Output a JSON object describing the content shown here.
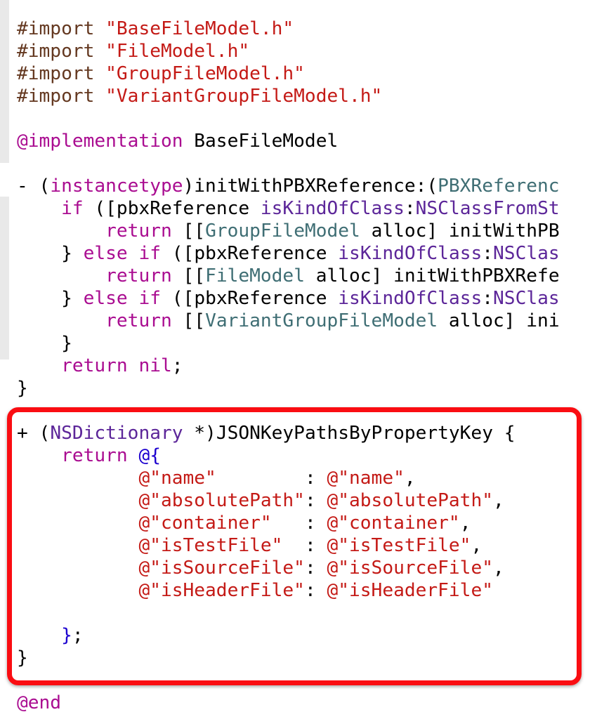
{
  "editor": {
    "lines": [
      [
        {
          "text": "#import ",
          "kind": "directive"
        },
        {
          "text": "\"BaseFileModel.h\"",
          "kind": "string"
        }
      ],
      [
        {
          "text": "#import ",
          "kind": "directive"
        },
        {
          "text": "\"FileModel.h\"",
          "kind": "string"
        }
      ],
      [
        {
          "text": "#import ",
          "kind": "directive"
        },
        {
          "text": "\"GroupFileModel.h\"",
          "kind": "string"
        }
      ],
      [
        {
          "text": "#import ",
          "kind": "directive"
        },
        {
          "text": "\"VariantGroupFileModel.h\"",
          "kind": "string"
        }
      ],
      [],
      [
        {
          "text": "@implementation",
          "kind": "keyword"
        },
        {
          "text": " BaseFileModel",
          "kind": "plain"
        }
      ],
      [],
      [
        {
          "text": "- (",
          "kind": "plain"
        },
        {
          "text": "instancetype",
          "kind": "keyword"
        },
        {
          "text": ")initWithPBXReference:(",
          "kind": "plain"
        },
        {
          "text": "PBXReferenc",
          "kind": "project-class"
        }
      ],
      [
        {
          "text": "    ",
          "kind": "plain"
        },
        {
          "text": "if",
          "kind": "keyword"
        },
        {
          "text": " ([pbxReference ",
          "kind": "plain"
        },
        {
          "text": "isKindOfClass",
          "kind": "type"
        },
        {
          "text": ":",
          "kind": "plain"
        },
        {
          "text": "NSClassFromSt",
          "kind": "type"
        }
      ],
      [
        {
          "text": "        ",
          "kind": "plain"
        },
        {
          "text": "return",
          "kind": "keyword"
        },
        {
          "text": " [[",
          "kind": "plain"
        },
        {
          "text": "GroupFileModel",
          "kind": "project-class"
        },
        {
          "text": " alloc] initWithPB",
          "kind": "plain"
        }
      ],
      [
        {
          "text": "    } ",
          "kind": "plain"
        },
        {
          "text": "else",
          "kind": "keyword"
        },
        {
          "text": " ",
          "kind": "plain"
        },
        {
          "text": "if",
          "kind": "keyword"
        },
        {
          "text": " ([pbxReference ",
          "kind": "plain"
        },
        {
          "text": "isKindOfClass",
          "kind": "type"
        },
        {
          "text": ":",
          "kind": "plain"
        },
        {
          "text": "NSClas",
          "kind": "type"
        }
      ],
      [
        {
          "text": "        ",
          "kind": "plain"
        },
        {
          "text": "return",
          "kind": "keyword"
        },
        {
          "text": " [[",
          "kind": "plain"
        },
        {
          "text": "FileModel",
          "kind": "project-class"
        },
        {
          "text": " alloc] initWithPBXRefe",
          "kind": "plain"
        }
      ],
      [
        {
          "text": "    } ",
          "kind": "plain"
        },
        {
          "text": "else",
          "kind": "keyword"
        },
        {
          "text": " ",
          "kind": "plain"
        },
        {
          "text": "if",
          "kind": "keyword"
        },
        {
          "text": " ([pbxReference ",
          "kind": "plain"
        },
        {
          "text": "isKindOfClass",
          "kind": "type"
        },
        {
          "text": ":",
          "kind": "plain"
        },
        {
          "text": "NSClas",
          "kind": "type"
        }
      ],
      [
        {
          "text": "        ",
          "kind": "plain"
        },
        {
          "text": "return",
          "kind": "keyword"
        },
        {
          "text": " [[",
          "kind": "plain"
        },
        {
          "text": "VariantGroupFileModel",
          "kind": "project-class"
        },
        {
          "text": " alloc] ini",
          "kind": "plain"
        }
      ],
      [
        {
          "text": "    }",
          "kind": "plain"
        }
      ],
      [
        {
          "text": "    ",
          "kind": "plain"
        },
        {
          "text": "return",
          "kind": "keyword"
        },
        {
          "text": " ",
          "kind": "plain"
        },
        {
          "text": "nil",
          "kind": "keyword"
        },
        {
          "text": ";",
          "kind": "plain"
        }
      ],
      [
        {
          "text": "}",
          "kind": "plain"
        }
      ],
      [],
      [
        {
          "text": "+ (",
          "kind": "plain"
        },
        {
          "text": "NSDictionary",
          "kind": "type"
        },
        {
          "text": " *)JSONKeyPathsByPropertyKey {",
          "kind": "plain"
        }
      ],
      [
        {
          "text": "    ",
          "kind": "plain"
        },
        {
          "text": "return",
          "kind": "keyword"
        },
        {
          "text": " ",
          "kind": "plain"
        },
        {
          "text": "@{",
          "kind": "brace-blue"
        }
      ],
      [
        {
          "text": "           ",
          "kind": "plain"
        },
        {
          "text": "@\"name\"",
          "kind": "string"
        },
        {
          "text": "        : ",
          "kind": "plain"
        },
        {
          "text": "@\"name\"",
          "kind": "string"
        },
        {
          "text": ",",
          "kind": "plain"
        }
      ],
      [
        {
          "text": "           ",
          "kind": "plain"
        },
        {
          "text": "@\"absolutePath\"",
          "kind": "string"
        },
        {
          "text": ": ",
          "kind": "plain"
        },
        {
          "text": "@\"absolutePath\"",
          "kind": "string"
        },
        {
          "text": ",",
          "kind": "plain"
        }
      ],
      [
        {
          "text": "           ",
          "kind": "plain"
        },
        {
          "text": "@\"container\"",
          "kind": "string"
        },
        {
          "text": "   : ",
          "kind": "plain"
        },
        {
          "text": "@\"container\"",
          "kind": "string"
        },
        {
          "text": ",",
          "kind": "plain"
        }
      ],
      [
        {
          "text": "           ",
          "kind": "plain"
        },
        {
          "text": "@\"isTestFile\"",
          "kind": "string"
        },
        {
          "text": "  : ",
          "kind": "plain"
        },
        {
          "text": "@\"isTestFile\"",
          "kind": "string"
        },
        {
          "text": ",",
          "kind": "plain"
        }
      ],
      [
        {
          "text": "           ",
          "kind": "plain"
        },
        {
          "text": "@\"isSourceFile\"",
          "kind": "string"
        },
        {
          "text": ": ",
          "kind": "plain"
        },
        {
          "text": "@\"isSourceFile\"",
          "kind": "string"
        },
        {
          "text": ",",
          "kind": "plain"
        }
      ],
      [
        {
          "text": "           ",
          "kind": "plain"
        },
        {
          "text": "@\"isHeaderFile\"",
          "kind": "string"
        },
        {
          "text": ": ",
          "kind": "plain"
        },
        {
          "text": "@\"isHeaderFile\"",
          "kind": "string"
        }
      ],
      [],
      [
        {
          "text": "    ",
          "kind": "plain"
        },
        {
          "text": "}",
          "kind": "brace-blue"
        },
        {
          "text": ";",
          "kind": "plain"
        }
      ],
      [
        {
          "text": "}",
          "kind": "plain"
        }
      ],
      [],
      [
        {
          "text": "@end",
          "kind": "keyword"
        }
      ]
    ]
  },
  "colors": {
    "directive": "#643820",
    "string": "#c41a16",
    "keyword": "#aa0d91",
    "type": "#5c2699",
    "project-class": "#3f6e74",
    "highlight": "#fa0d12"
  }
}
